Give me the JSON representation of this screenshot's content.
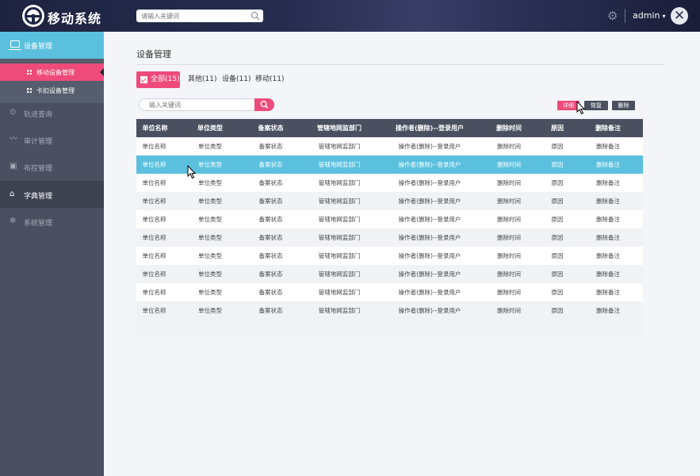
{
  "header": {
    "app_title": "移动系统",
    "search_placeholder": "请输入关键词",
    "user": "admin",
    "icons": [
      "logo-icon",
      "search-icon",
      "gear-icon",
      "chevron-down-icon",
      "close-icon"
    ]
  },
  "sidebar": {
    "top_item": "设备管理",
    "sub_items": [
      {
        "label": "移动设备管理",
        "active": true
      },
      {
        "label": "卡扣设备管理",
        "active": false
      }
    ],
    "items": [
      {
        "label": "轨迹查询",
        "icon": "⊙"
      },
      {
        "label": "审计管理",
        "icon": "〰"
      },
      {
        "label": "布控管理",
        "icon": "▣"
      },
      {
        "label": "字典管理",
        "icon": "⌂"
      },
      {
        "label": "系统管理",
        "icon": "✲"
      }
    ]
  },
  "main": {
    "title": "设备管理",
    "tabs": [
      {
        "label": "全部(15)",
        "active": true
      },
      {
        "label": "其他(11)",
        "active": false
      },
      {
        "label": "设备(11)",
        "active": false
      },
      {
        "label": "移动(11)",
        "active": false
      }
    ],
    "search_placeholder": "输入关键词",
    "actions": {
      "detail": "详细",
      "restore": "恢复",
      "delete": "删除"
    },
    "table": {
      "columns": [
        "单位名称",
        "单位类型",
        "备案状态",
        "管辖地网监部门",
        "操作者(删除)--登录用户",
        "删除时间",
        "原因",
        "删除备注"
      ],
      "row": [
        "单位名称",
        "单位类型",
        "备案状态",
        "管辖地网监部门",
        "操作者(删除)--登录用户",
        "删除时间",
        "原因",
        "删除备注"
      ],
      "row_count": 10,
      "highlighted_row": 2
    }
  }
}
